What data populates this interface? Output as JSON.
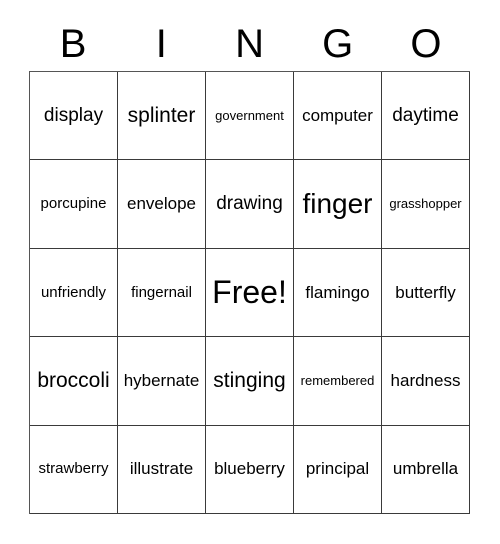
{
  "card": {
    "headers": [
      "B",
      "I",
      "N",
      "G",
      "O"
    ],
    "rows": [
      [
        {
          "text": "display",
          "size": "l"
        },
        {
          "text": "splinter",
          "size": "xl"
        },
        {
          "text": "government",
          "size": "xs"
        },
        {
          "text": "computer",
          "size": "m"
        },
        {
          "text": "daytime",
          "size": "l"
        }
      ],
      [
        {
          "text": "porcupine",
          "size": "s"
        },
        {
          "text": "envelope",
          "size": "m"
        },
        {
          "text": "drawing",
          "size": "l"
        },
        {
          "text": "finger",
          "size": "xxl"
        },
        {
          "text": "grasshopper",
          "size": "xs"
        }
      ],
      [
        {
          "text": "unfriendly",
          "size": "s"
        },
        {
          "text": "fingernail",
          "size": "s"
        },
        {
          "text": "Free!",
          "size": "free"
        },
        {
          "text": "flamingo",
          "size": "m"
        },
        {
          "text": "butterfly",
          "size": "m"
        }
      ],
      [
        {
          "text": "broccoli",
          "size": "xl"
        },
        {
          "text": "hybernate",
          "size": "m"
        },
        {
          "text": "stinging",
          "size": "xl"
        },
        {
          "text": "remembered",
          "size": "xs"
        },
        {
          "text": "hardness",
          "size": "m"
        }
      ],
      [
        {
          "text": "strawberry",
          "size": "s"
        },
        {
          "text": "illustrate",
          "size": "m"
        },
        {
          "text": "blueberry",
          "size": "m"
        },
        {
          "text": "principal",
          "size": "m"
        },
        {
          "text": "umbrella",
          "size": "m"
        }
      ]
    ],
    "colors": {
      "background": "#ffffff",
      "text": "#000000",
      "grid_line": "#3a3a3a"
    }
  }
}
